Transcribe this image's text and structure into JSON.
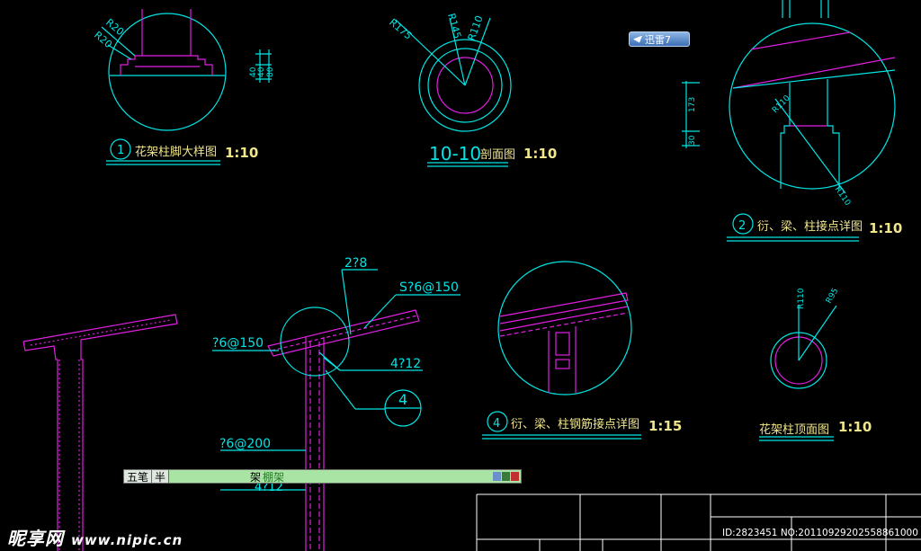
{
  "drawing": {
    "colors": {
      "cyan": "#00e5e5",
      "magenta": "#e020e0",
      "white": "#ffffff"
    },
    "detail1": {
      "number": "1",
      "title": "花架柱脚大样图",
      "scale": "1:10",
      "r_labels": [
        "R20",
        "R20"
      ],
      "dims": [
        "40",
        "40",
        "80"
      ]
    },
    "detail10": {
      "title_num": "10-10",
      "title": "剖面图",
      "scale": "1:10",
      "r_labels": [
        "R175",
        "R145",
        "R110"
      ]
    },
    "detail2": {
      "number": "2",
      "title": "衍、梁、柱接点详图",
      "scale": "1:10",
      "dims": [
        "173",
        "30"
      ],
      "r_labels": [
        "R110",
        "R110"
      ]
    },
    "detail4": {
      "number": "4",
      "title": "衍、梁、柱钢筋接点详图",
      "scale": "1:15"
    },
    "detail_top": {
      "title": "花架柱顶面图",
      "scale": "1:10",
      "r_labels": [
        "R110",
        "R95"
      ]
    },
    "rebar": {
      "l1": "2?8",
      "l2": "S?6@150",
      "l3": "?6@150",
      "l4": "4?12",
      "l5": "?6@200",
      "l6": "4?12",
      "callout": "4"
    }
  },
  "overlay": {
    "ime": {
      "mode": "五笔",
      "width": "半",
      "composition_a": "架",
      "composition_b": "棚架"
    },
    "xunlei": {
      "label": "迅雷7"
    },
    "watermark": {
      "site": "昵享网",
      "url": "www.nipic.cn",
      "id_text": "ID:2823451 NO:20110929202558861000"
    }
  }
}
